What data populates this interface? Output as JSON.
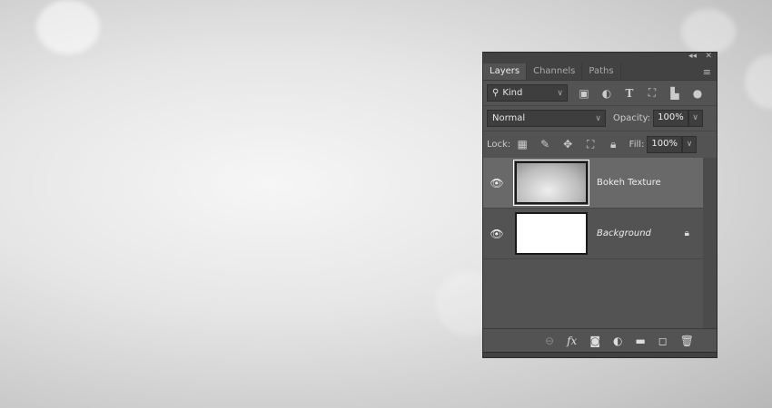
{
  "panel": {
    "collapse_icon": "double-chevron-left",
    "close_icon": "close",
    "tabs": [
      {
        "label": "Layers"
      },
      {
        "label": "Channels"
      },
      {
        "label": "Paths"
      }
    ],
    "filter": {
      "kind_label": "Kind"
    },
    "blend_mode": "Normal",
    "opacity_label": "Opacity:",
    "opacity_value": "100%",
    "lock_label": "Lock:",
    "fill_label": "Fill:",
    "fill_value": "100%",
    "layers": [
      {
        "name": "Bokeh Texture",
        "selected": true,
        "visible": true,
        "smart_object": true
      },
      {
        "name": "Background",
        "selected": false,
        "visible": true,
        "locked": true
      }
    ]
  }
}
